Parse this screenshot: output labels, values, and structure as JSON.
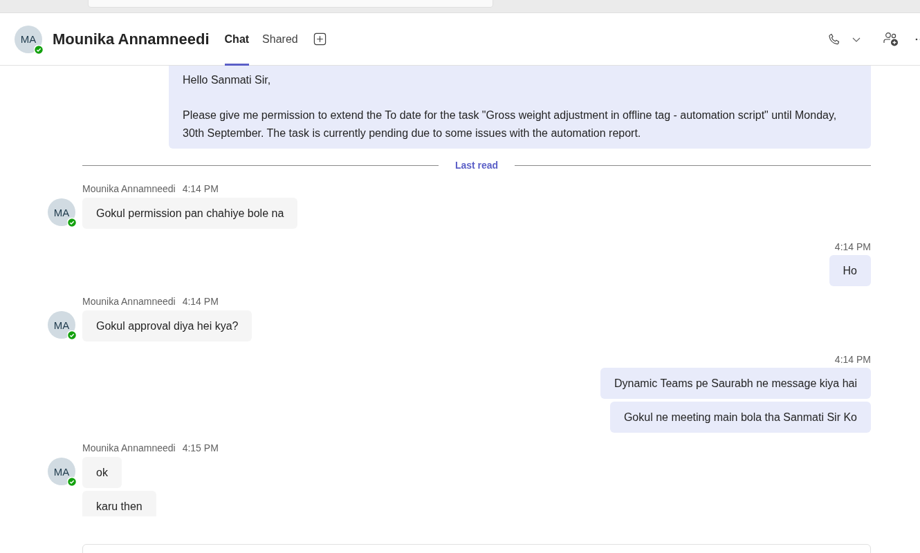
{
  "header": {
    "avatar": "MA",
    "available": true,
    "name": "Mounika Annamneedi",
    "tabs": [
      {
        "label": "Chat",
        "selected": true
      },
      {
        "label": "Shared",
        "selected": false
      }
    ]
  },
  "messages": [
    {
      "kind": "sent",
      "bubbles": [
        "Hello Sanmati Sir,\n\nPlease give me permission to extend the To date for the task \"Gross weight adjustment in offline tag - automation script\" until Monday, 30th September. The task is currently pending due to some issues with the automation report."
      ]
    },
    {
      "kind": "divider",
      "label": "Last read"
    },
    {
      "kind": "received",
      "avatar": "MA",
      "available": true,
      "author": "Mounika Annamneedi",
      "time": "4:14 PM",
      "bubbles": [
        "Gokul permission pan chahiye bole na"
      ]
    },
    {
      "kind": "sent",
      "time": "4:14 PM",
      "bubbles": [
        "Ho"
      ]
    },
    {
      "kind": "received",
      "avatar": "MA",
      "available": true,
      "author": "Mounika Annamneedi",
      "time": "4:14 PM",
      "bubbles": [
        "Gokul approval diya hei kya?"
      ]
    },
    {
      "kind": "sent",
      "time": "4:14 PM",
      "bubbles": [
        "Dynamic Teams pe Saurabh ne message kiya hai",
        "Gokul ne meeting main bola tha Sanmati Sir Ko"
      ]
    },
    {
      "kind": "received",
      "avatar": "MA",
      "available": true,
      "author": "Mounika Annamneedi",
      "time": "4:15 PM",
      "bubbles": [
        "ok",
        "karu then"
      ]
    }
  ]
}
